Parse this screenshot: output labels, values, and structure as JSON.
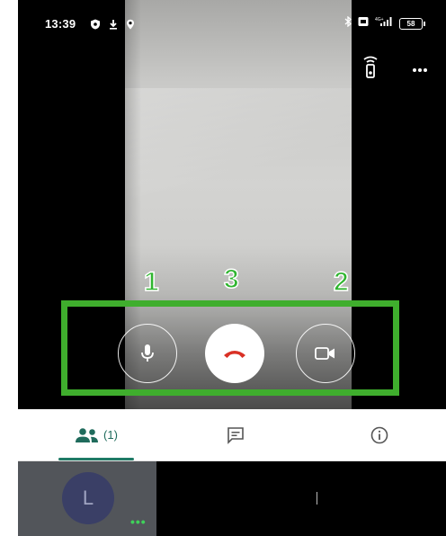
{
  "status_bar": {
    "time": "13:39",
    "battery": "58",
    "network": "4G+"
  },
  "annotations": {
    "mic": "1",
    "end_call": "3",
    "camera": "2"
  },
  "tabs": {
    "people_count": "(1)"
  },
  "participant": {
    "initial": "L"
  },
  "colors": {
    "annotation_green": "#3fae2d",
    "end_call_red": "#d93025",
    "tab_accent": "#1f7a66"
  }
}
